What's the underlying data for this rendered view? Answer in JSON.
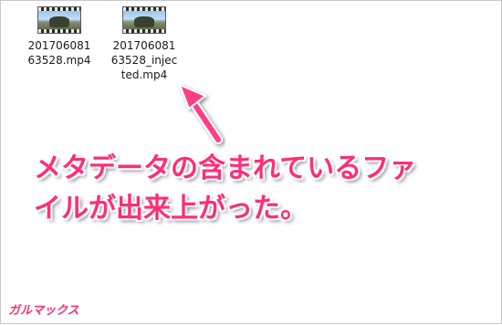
{
  "files": [
    {
      "name_line1": "201706081",
      "name_line2": "63528.mp4",
      "name_line3": "",
      "icon": "video-thumbnail-icon"
    },
    {
      "name_line1": "201706081",
      "name_line2": "63528_injec",
      "name_line3": "ted.mp4",
      "icon": "video-thumbnail-icon"
    }
  ],
  "annotation": {
    "line1": "メタデータの含まれているファ",
    "line2": "イルが出来上がった。",
    "color": "#ff2d78"
  },
  "watermark": {
    "text": "ガルマックス"
  }
}
